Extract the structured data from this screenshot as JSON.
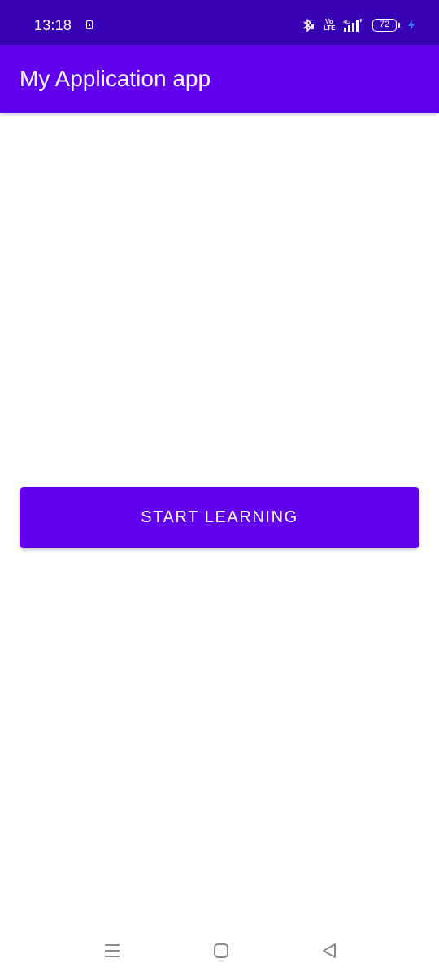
{
  "status_bar": {
    "time": "13:18",
    "volte_top": "Vo",
    "volte_bottom": "LTE",
    "network_type": "4G",
    "battery_level": "72",
    "icons": [
      "sim-icon",
      "bluetooth-icon",
      "volte-icon",
      "signal-icon",
      "battery-icon",
      "charging-icon"
    ],
    "background_color": "#3700B3"
  },
  "app_bar": {
    "title": "My Application app",
    "background_color": "#6200EE"
  },
  "main": {
    "start_button_label": "START LEARNING",
    "button_color": "#6200EE"
  },
  "navigation_bar": {
    "icons": [
      "menu-icon",
      "home-icon",
      "back-icon"
    ]
  }
}
